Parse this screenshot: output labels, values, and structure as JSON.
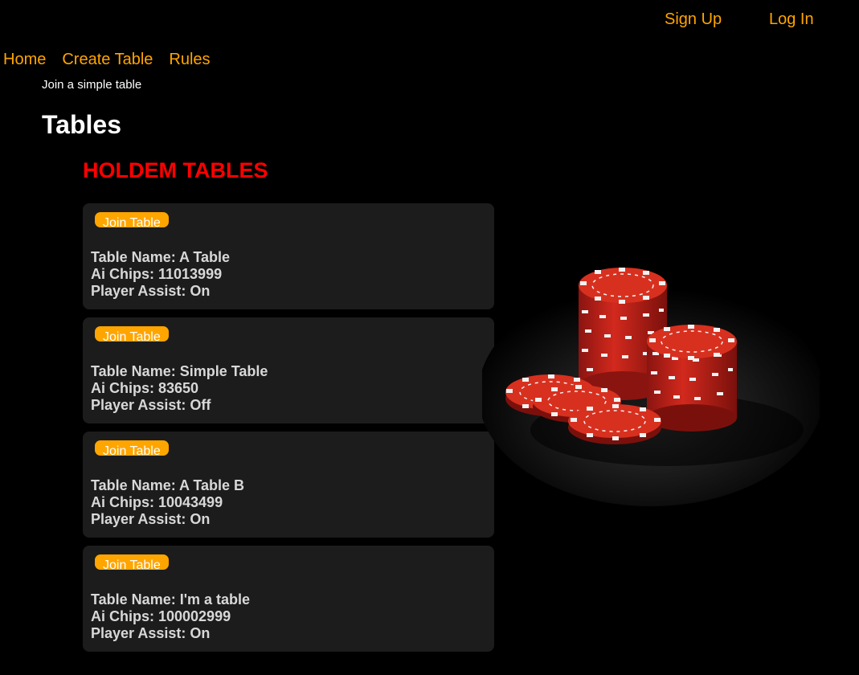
{
  "header": {
    "signup_label": "Sign Up",
    "login_label": "Log In"
  },
  "nav": {
    "items": [
      {
        "label": "Home"
      },
      {
        "label": "Create Table"
      },
      {
        "label": "Rules"
      }
    ]
  },
  "main": {
    "subtitle": "Join a simple table",
    "title": "Tables",
    "section_title": "HOLDEM TABLES",
    "tables": [
      {
        "button": "Join Table",
        "name": "Table Name: A Table",
        "chips": "Ai Chips: 11013999",
        "assist": "Player Assist: On"
      },
      {
        "button": "Join Table",
        "name": "Table Name: Simple Table",
        "chips": "Ai Chips: 83650",
        "assist": "Player Assist: Off"
      },
      {
        "button": "Join Table",
        "name": "Table Name: A Table B",
        "chips": "Ai Chips: 10043499",
        "assist": "Player Assist: On"
      },
      {
        "button": "Join Table",
        "name": "Table Name: I'm a table",
        "chips": "Ai Chips: 100002999",
        "assist": "Player Assist: On"
      }
    ]
  },
  "colors": {
    "background": "#000000",
    "link": "#ffa500",
    "section_title": "#ff0000",
    "card_bg": "#1c1c1c",
    "button_bg": "#ffa500"
  },
  "image": {
    "icon": "poker-chips-image"
  }
}
